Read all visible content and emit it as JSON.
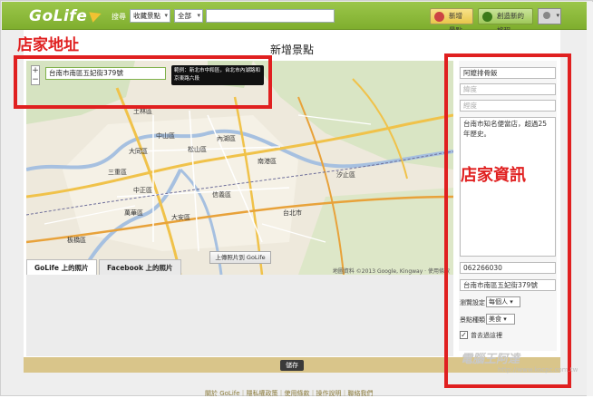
{
  "app": {
    "logo": "GoLife"
  },
  "topbar": {
    "search_label": "搜尋",
    "category_select": "收藏景點",
    "area_select": "全部",
    "search_value": "",
    "new_spot_button": "新增景點",
    "new_trip_button": "創造新的旅程"
  },
  "page": {
    "title": "新增景點"
  },
  "map": {
    "address_value": "台南市南區五妃街379號",
    "hint": "範例：新北市中和區，台北市內湖路和京東路六段",
    "zoom_in": "+",
    "zoom_out": "−",
    "tab_golife": "GoLife 上的照片",
    "tab_facebook": "Facebook 上的照片",
    "attribution": "地圖資料 ©2013 Google, Kingway · 使用條款",
    "upload_button": "上傳照片到 GoLife",
    "place_labels": [
      "土林區",
      "中山區",
      "松山區",
      "內湖區",
      "南港區",
      "大同區",
      "三重區",
      "萬華區",
      "中正區",
      "大安區",
      "信義區",
      "板橋區",
      "汐止區",
      "台北市"
    ]
  },
  "form": {
    "name_value": "阿嬤排骨飯",
    "latitude_placeholder": "緯度",
    "longitude_placeholder": "經度",
    "description_value": "台南市知名便當店，超過25年歷史。",
    "phone_value": "062266030",
    "address_value": "台南市南區五妃街379號",
    "privacy_label": "瀏覽設定",
    "privacy_value": "每個人",
    "type_label": "景點種類",
    "type_value": "美食",
    "visited_label": "曾去過這裡"
  },
  "actions": {
    "save_button": "儲存"
  },
  "footer": {
    "text": "關於 GoLife｜隱私權政策｜使用條款｜操作說明｜聯絡我們"
  },
  "annotations": {
    "left_label": "店家地址",
    "right_label": "店家資訊"
  },
  "watermark": {
    "name": "電腦王阿達",
    "url": "http://www.kocpc.com.tw"
  },
  "colors": {
    "topbar": "#8ab83c",
    "annotation_red": "#e02020",
    "save_bar": "#d9c58a"
  }
}
